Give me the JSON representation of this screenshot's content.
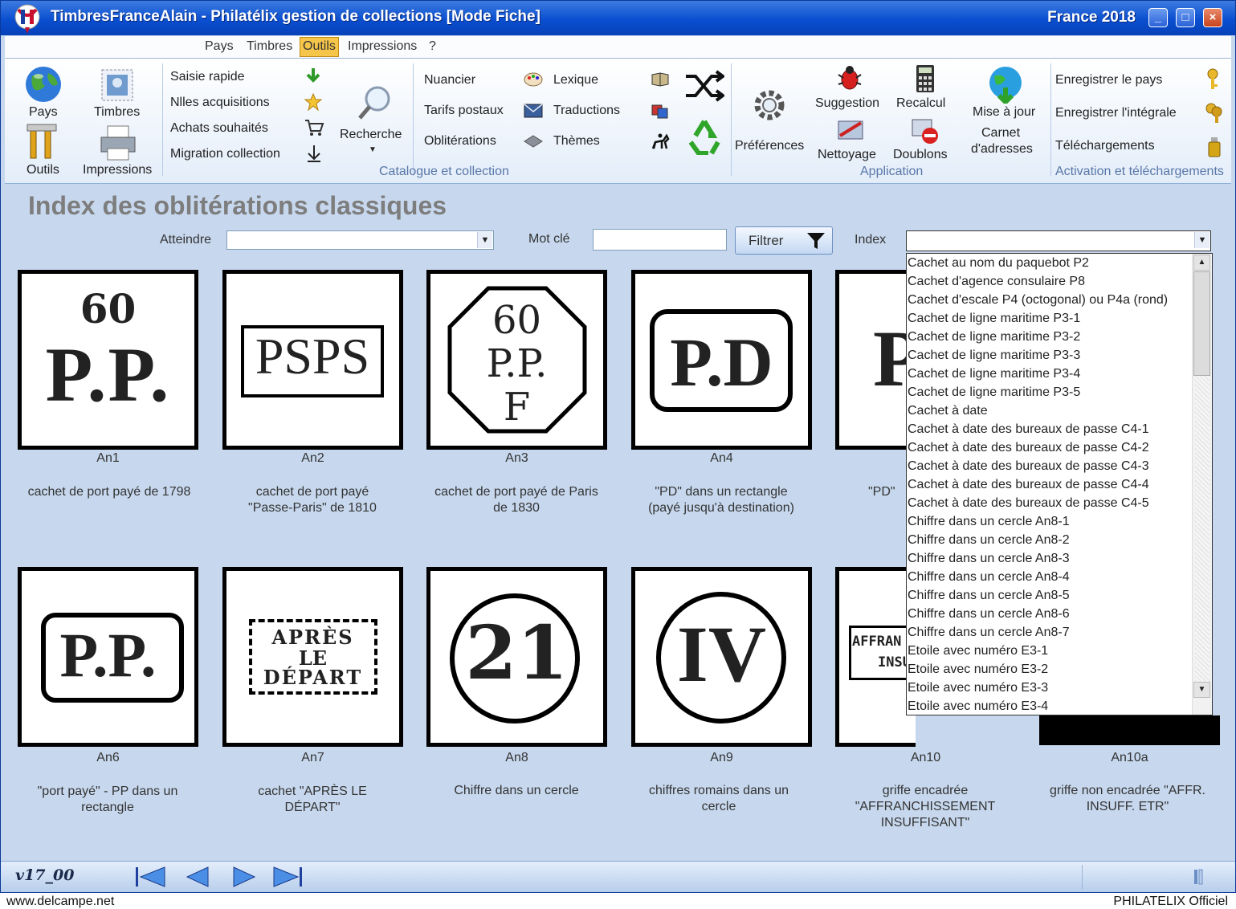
{
  "window": {
    "title": "TimbresFranceAlain - Philatélix gestion de collections [Mode Fiche]",
    "right_title": "France 2018",
    "minimize": "_",
    "maximize": "□",
    "close": "×"
  },
  "menu": [
    "Pays",
    "Timbres",
    "Outils",
    "Impressions",
    "?"
  ],
  "menu_active": "Outils",
  "ribbon": {
    "nav_buttons": {
      "pays": "Pays",
      "timbres": "Timbres",
      "outils": "Outils",
      "impressions": "Impressions"
    },
    "catalogue": {
      "saisie": "Saisie rapide",
      "nlles": "Nlles acquisitions",
      "achats": "Achats souhaités",
      "migration": "Migration collection",
      "recherche": "Recherche",
      "nuancier": "Nuancier",
      "tarifs": "Tarifs postaux",
      "obliterations": "Oblitérations",
      "lexique": "Lexique",
      "traductions": "Traductions",
      "themes": "Thèmes",
      "group_label": "Catalogue et collection"
    },
    "application": {
      "preferences": "Préférences",
      "suggestion": "Suggestion",
      "nettoyage": "Nettoyage",
      "recalcul": "Recalcul",
      "doublons": "Doublons",
      "maj_line1": "Mise à jour",
      "maj_line2": "Carnet",
      "maj_line3": "d'adresses",
      "group_label": "Application"
    },
    "activation": {
      "enregistrer_pays": "Enregistrer le pays",
      "enregistrer_integrale": "Enregistrer l'intégrale",
      "telechargements": "Téléchargements",
      "group_label": "Activation et téléchargements"
    }
  },
  "page": {
    "title": "Index des oblitérations classiques",
    "atteindre_label": "Atteindre",
    "motcle_label": "Mot clé",
    "filter_label": "Filtrer",
    "index_label": "Index",
    "atteindre_value": "",
    "motcle_value": "",
    "index_value": ""
  },
  "stamps": [
    {
      "code": "An1",
      "desc1": "cachet de port payé de 1798",
      "desc2": "",
      "desc3": ""
    },
    {
      "code": "An2",
      "desc1": "cachet de port payé",
      "desc2": "\"Passe-Paris\" de 1810",
      "desc3": ""
    },
    {
      "code": "An3",
      "desc1": "cachet de port payé de Paris",
      "desc2": "de 1830",
      "desc3": ""
    },
    {
      "code": "An4",
      "desc1": "\"PD\" dans un rectangle",
      "desc2": "(payé jusqu'à destination)",
      "desc3": ""
    },
    {
      "code": "",
      "desc1": "\"PD\"",
      "desc2": "",
      "desc3": ""
    },
    {
      "code": "An6",
      "desc1": "\"port payé\" - PP dans un",
      "desc2": "rectangle",
      "desc3": ""
    },
    {
      "code": "An7",
      "desc1": "cachet \"APRÈS LE",
      "desc2": "DÉPART\"",
      "desc3": ""
    },
    {
      "code": "An8",
      "desc1": "Chiffre dans un cercle",
      "desc2": "",
      "desc3": ""
    },
    {
      "code": "An9",
      "desc1": "chiffres romains dans un",
      "desc2": "cercle",
      "desc3": ""
    },
    {
      "code": "An10",
      "desc1": "griffe encadrée",
      "desc2": "\"AFFRANCHISSEMENT",
      "desc3": "INSUFFISANT\""
    },
    {
      "code": "An10a",
      "desc1": "griffe non encadrée \"AFFR.",
      "desc2": "INSUFF. ETR\"",
      "desc3": ""
    }
  ],
  "stamp_marks": {
    "an1_top": "60",
    "an1_main": "P.P.",
    "an2": "PSPS",
    "an3_l1": "60",
    "an3_l2": "P.P.",
    "an3_l3": "F",
    "an4": "P.D",
    "an5": "P",
    "an6": "P.P.",
    "an7_l1": "APRÈS",
    "an7_l2": "LE",
    "an7_l3": "DÉPART",
    "an8": "21",
    "an9": "IV",
    "an10_l1": "AFFRAN",
    "an10_l2": "INSU"
  },
  "index_options": [
    "Cachet au nom du paquebot P2",
    "Cachet d'agence consulaire P8",
    "Cachet d'escale P4 (octogonal) ou P4a (rond)",
    "Cachet de ligne maritime P3-1",
    "Cachet de ligne maritime P3-2",
    "Cachet de ligne maritime P3-3",
    "Cachet de ligne maritime P3-4",
    "Cachet de ligne maritime P3-5",
    "Cachet à date",
    "Cachet à date des bureaux de passe C4-1",
    "Cachet à date des bureaux de passe C4-2",
    "Cachet à date des bureaux de passe C4-3",
    "Cachet à date des bureaux de passe C4-4",
    "Cachet à date des bureaux de passe C4-5",
    "Chiffre dans un cercle An8-1",
    "Chiffre dans un cercle An8-2",
    "Chiffre dans un cercle An8-3",
    "Chiffre dans un cercle An8-4",
    "Chiffre dans un cercle An8-5",
    "Chiffre dans un cercle An8-6",
    "Chiffre dans un cercle An8-7",
    "Etoile avec numéro E3-1",
    "Etoile avec numéro E3-2",
    "Etoile avec numéro E3-3",
    "Etoile avec numéro E3-4"
  ],
  "status": {
    "version": "v17_00"
  },
  "footer": {
    "left": "www.delcampe.net",
    "right": "PHILATELIX Officiel"
  },
  "colors": {
    "titlebar": "#0a4fd0",
    "background": "#c7d8ee",
    "menu_active": "#f6c64a",
    "group_label": "#5877a8"
  },
  "icons": [
    "globe-icon",
    "stamp-icon",
    "tools-icon",
    "printer-icon",
    "magnifier-icon",
    "gear-icon",
    "bug-icon",
    "calculator-icon",
    "globe-update-icon",
    "key-icon",
    "funnel-icon",
    "shuffle-icon",
    "recycle-icon"
  ]
}
